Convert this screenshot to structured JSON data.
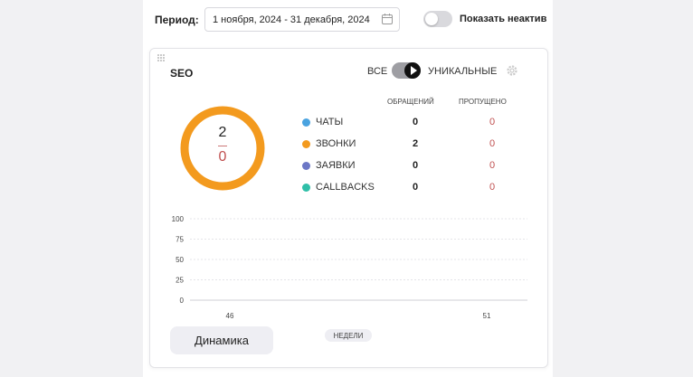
{
  "filters": {
    "period_label": "Период:",
    "date_range": "1 ноября, 2024 - 31 декабря, 2024",
    "show_inactive_label": "Показать неактив",
    "show_inactive_on": false
  },
  "card": {
    "title": "SEO",
    "mode_all": "ВСЕ",
    "mode_unique": "УНИКАЛЬНЫЕ",
    "total": "2",
    "missed_total": "0",
    "col_requests": "ОБРАЩЕНИЙ",
    "col_missed": "ПРОПУЩЕНО",
    "rows": [
      {
        "name": "ЧАТЫ",
        "requests": "0",
        "missed": "0",
        "color": "#4aa3e0"
      },
      {
        "name": "ЗВОНКИ",
        "requests": "2",
        "missed": "0",
        "color": "#f39a1e"
      },
      {
        "name": "ЗАЯВКИ",
        "requests": "0",
        "missed": "0",
        "color": "#6c77c6"
      },
      {
        "name": "CALLBACKS",
        "requests": "0",
        "missed": "0",
        "color": "#2fbfa8"
      }
    ],
    "dynamics_button": "Динамика",
    "weeks_label": "НЕДЕЛИ"
  },
  "colors": {
    "donut": "#f39a1e",
    "missed": "#c05050"
  },
  "chart_data": {
    "type": "line",
    "x": [
      "46",
      "51"
    ],
    "y_ticks": [
      "100",
      "75",
      "50",
      "25",
      "0"
    ],
    "ylim": [
      0,
      100
    ],
    "series": [],
    "xlabel": "НЕДЕЛИ",
    "ylabel": "",
    "title": "",
    "grid": true
  }
}
